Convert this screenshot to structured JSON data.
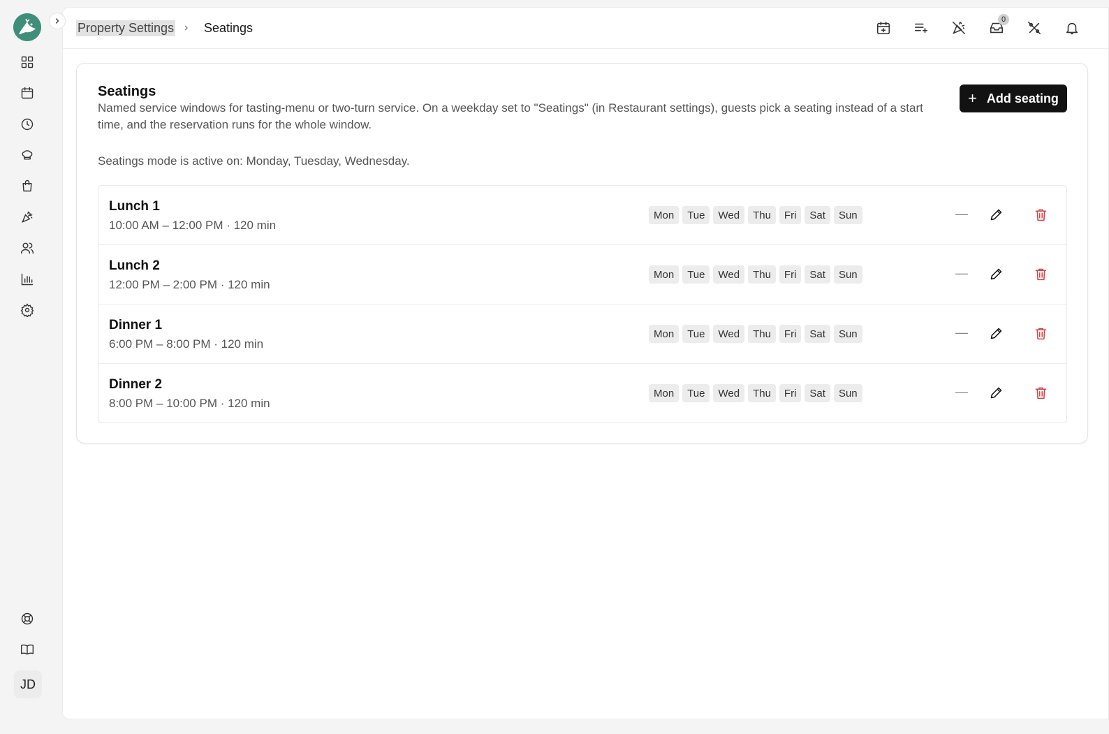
{
  "colors": {
    "brand": "#3f8e79",
    "primary_button": "#121212",
    "danger": "#d64545",
    "muted_text": "#555555"
  },
  "sidebar": {
    "expand_icon": "chevron-right-icon",
    "items": [
      {
        "name": "dashboard",
        "icon": "grid-icon"
      },
      {
        "name": "calendar",
        "icon": "calendar-icon"
      },
      {
        "name": "history",
        "icon": "clock-icon"
      },
      {
        "name": "kitchen",
        "icon": "chef-hat-icon"
      },
      {
        "name": "shop",
        "icon": "shopping-bag-icon"
      },
      {
        "name": "events",
        "icon": "party-popper-icon"
      },
      {
        "name": "guests",
        "icon": "users-icon"
      },
      {
        "name": "reports",
        "icon": "bar-chart-icon"
      },
      {
        "name": "settings",
        "icon": "gear-icon"
      }
    ],
    "bottom_items": [
      {
        "name": "support",
        "icon": "lifebuoy-icon"
      },
      {
        "name": "docs",
        "icon": "book-icon"
      }
    ],
    "avatar_initials": "JD"
  },
  "header": {
    "breadcrumb_root": "Property Settings",
    "breadcrumb_separator": "›",
    "breadcrumb_current": "Seatings",
    "icons": [
      "calendar-plus-icon",
      "list-add-icon",
      "party-popper-off-icon",
      "inbox-icon",
      "percent-off-icon",
      "bell-icon"
    ],
    "inbox_count": "0"
  },
  "card": {
    "title": "Seatings",
    "description": "Named service windows for tasting-menu or two-turn service. On a weekday set to \"Seatings\" (in Restaurant settings), guests pick a seating instead of a start time, and the reservation runs for the whole window.",
    "note": "Seatings mode is active on: Monday, Tuesday, Wednesday.",
    "add_button": {
      "icon": "+",
      "label": "Add seating"
    }
  },
  "seatings": [
    {
      "name": "Lunch 1",
      "time": "10:00 AM – 12:00 PM · 120 min",
      "days": [
        "Mon",
        "Tue",
        "Wed",
        "Thu",
        "Fri",
        "Sat",
        "Sun"
      ],
      "status": "—"
    },
    {
      "name": "Lunch 2",
      "time": "12:00 PM – 2:00 PM · 120 min",
      "days": [
        "Mon",
        "Tue",
        "Wed",
        "Thu",
        "Fri",
        "Sat",
        "Sun"
      ],
      "status": "—"
    },
    {
      "name": "Dinner 1",
      "time": "6:00 PM – 8:00 PM · 120 min",
      "days": [
        "Mon",
        "Tue",
        "Wed",
        "Thu",
        "Fri",
        "Sat",
        "Sun"
      ],
      "status": "—"
    },
    {
      "name": "Dinner 2",
      "time": "8:00 PM – 10:00 PM · 120 min",
      "days": [
        "Mon",
        "Tue",
        "Wed",
        "Thu",
        "Fri",
        "Sat",
        "Sun"
      ],
      "status": "—"
    }
  ]
}
